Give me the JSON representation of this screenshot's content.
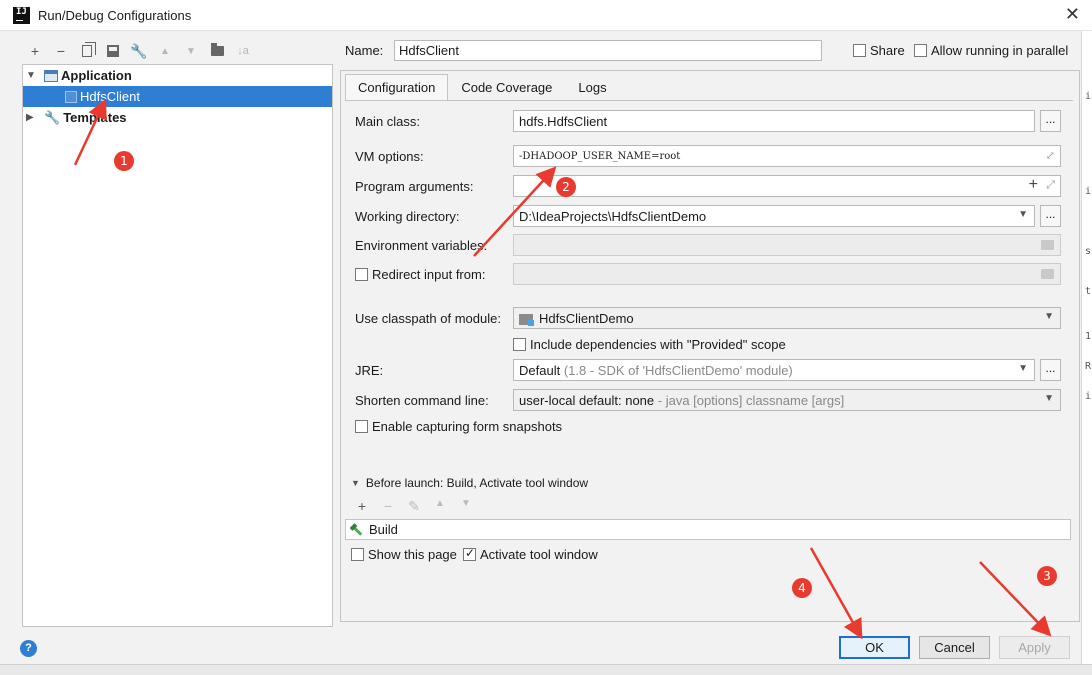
{
  "window": {
    "title": "Run/Debug Configurations",
    "close_glyph": "✕"
  },
  "toolbar": {
    "add": "+",
    "remove": "−",
    "up": "▲",
    "down": "▼",
    "sort": "↓a"
  },
  "tree": {
    "application_label": "Application",
    "selected_item": "HdfsClient",
    "templates_label": "Templates"
  },
  "name_row": {
    "label": "Name:",
    "value": "HdfsClient",
    "share_label": "Share",
    "parallel_label": "Allow running in parallel"
  },
  "tabs": [
    "Configuration",
    "Code Coverage",
    "Logs"
  ],
  "form": {
    "main_class_label": "Main class:",
    "main_class_value": "hdfs.HdfsClient",
    "vm_options_label": "VM options:",
    "vm_options_value": "-DHADOOP_USER_NAME=root",
    "program_args_label": "Program arguments:",
    "program_args_value": "",
    "working_dir_label": "Working directory:",
    "working_dir_value": "D:\\IdeaProjects\\HdfsClientDemo",
    "env_vars_label": "Environment variables:",
    "redirect_label": "Redirect input from:",
    "classpath_label": "Use classpath of module:",
    "classpath_value": "HdfsClientDemo",
    "include_deps_label": "Include dependencies with \"Provided\" scope",
    "jre_label": "JRE:",
    "jre_value": "Default",
    "jre_hint": "(1.8 - SDK of 'HdfsClientDemo' module)",
    "shorten_label": "Shorten command line:",
    "shorten_value": "user-local default: none",
    "shorten_hint": "- java [options] classname [args]",
    "snapshots_label": "Enable capturing form snapshots",
    "ellipsis": "..."
  },
  "before_launch": {
    "title": "Before launch: Build, Activate tool window",
    "task": "Build",
    "show_page_label": "Show this page",
    "activate_label": "Activate tool window"
  },
  "buttons": {
    "ok": "OK",
    "cancel": "Cancel",
    "apply": "Apply",
    "help": "?"
  },
  "annotations": [
    "1",
    "2",
    "3",
    "4"
  ],
  "colors": {
    "selection": "#2e7fd3",
    "annotation": "#e63b2e",
    "ok_border": "#1a6fd0"
  }
}
